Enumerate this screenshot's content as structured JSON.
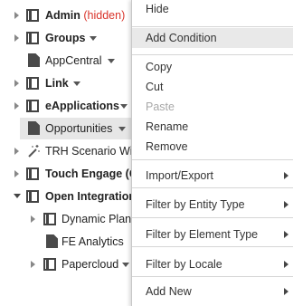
{
  "tree": {
    "items": [
      {
        "label": "Admin",
        "suffix": "(hidden)"
      },
      {
        "label": "Groups"
      },
      {
        "label": "AppCentral"
      },
      {
        "label": "Link"
      },
      {
        "label": "eApplications"
      },
      {
        "label": "Opportunities"
      },
      {
        "label": "TRH Scenario Wiz"
      },
      {
        "label": "Touch Engage (Gr"
      },
      {
        "label": "Open Integrations"
      },
      {
        "label": "Dynamic Plann"
      },
      {
        "label": "FE Analytics"
      },
      {
        "label": "Papercloud"
      }
    ]
  },
  "menu": {
    "items": [
      {
        "label": "Hide"
      },
      {
        "label": "Add Condition"
      },
      {
        "label": "Copy"
      },
      {
        "label": "Cut"
      },
      {
        "label": "Paste"
      },
      {
        "label": "Rename"
      },
      {
        "label": "Remove"
      },
      {
        "label": "Import/Export"
      },
      {
        "label": "Filter by Entity Type"
      },
      {
        "label": "Filter by Element Type"
      },
      {
        "label": "Filter by Locale"
      },
      {
        "label": "Add New"
      }
    ]
  }
}
